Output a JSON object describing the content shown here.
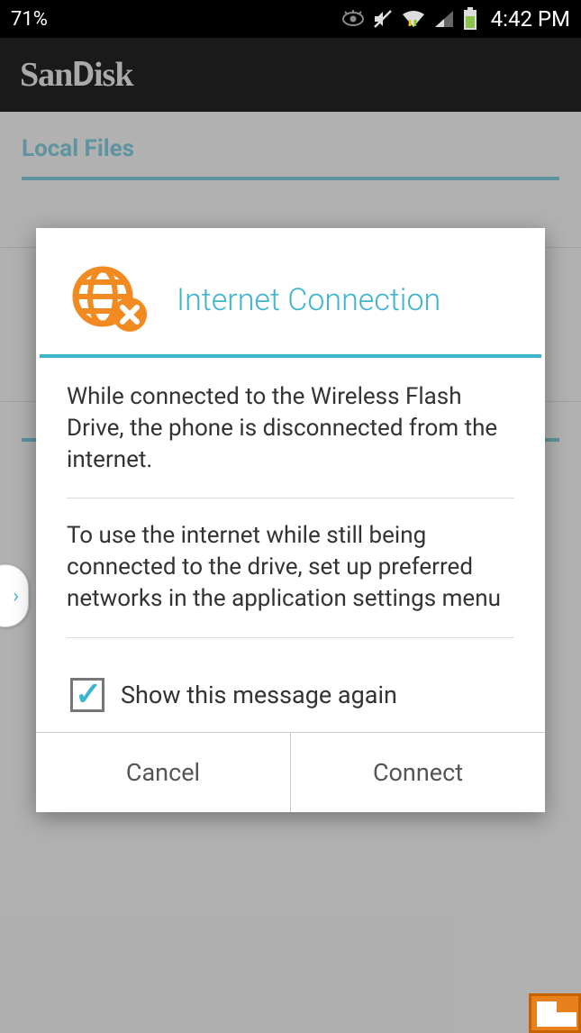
{
  "status_bar": {
    "battery_pct": "71%",
    "time": "4:42 PM",
    "icons": {
      "smart_stay": "smart-stay-icon",
      "mute": "mute-icon",
      "wifi": "wifi-icon",
      "signal": "signal-icon",
      "battery": "battery-icon"
    }
  },
  "app_header": {
    "brand": "SanDisk"
  },
  "tabs": {
    "local_files": "Local Files"
  },
  "dialog": {
    "icon_name": "globe-offline-icon",
    "title": "Internet Connection",
    "paragraph_1": "While connected to the Wireless Flash Drive, the phone is disconnected from the internet.",
    "paragraph_2": "To use the internet while still being connected to the drive, set up preferred networks in the application settings menu",
    "checkbox_label": "Show this message again",
    "checkbox_checked": true,
    "buttons": {
      "cancel": "Cancel",
      "connect": "Connect"
    }
  },
  "colors": {
    "accent": "#3fb4cf",
    "icon_orange": "#f18a21"
  }
}
